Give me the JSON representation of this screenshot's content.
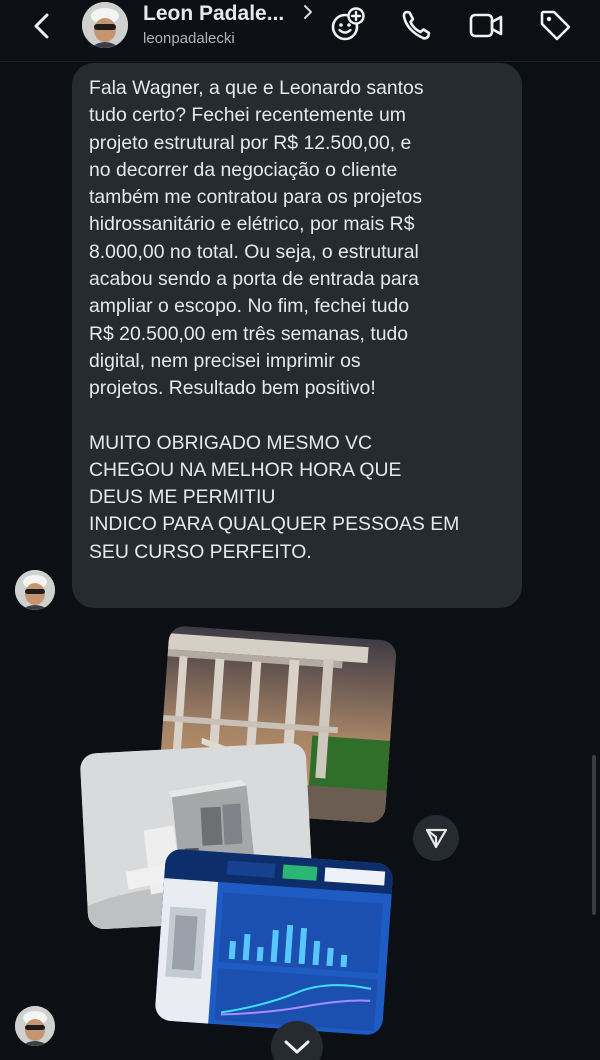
{
  "header": {
    "contact_name": "Leon Padale...",
    "handle": "leonpadalecki"
  },
  "message": {
    "paragraph1": "Fala Wagner, a que e Leonardo santos\ntudo certo? Fechei recentemente um\nprojeto estrutural por R$ 12.500,00, e\nno decorrer da negociação o cliente\ntambém me contratou para os projetos\nhidrossanitário e elétrico, por mais R$\n8.000,00 no total. Ou seja, o estrutural\nacabou sendo a porta de entrada para\nampliar o escopo. No fim, fechei tudo\nR$ 20.500,00 em três semanas, tudo\ndigital, nem precisei imprimir os\nprojetos. Resultado bem positivo!",
    "paragraph2": "MUITO OBRIGADO MESMO VC\nCHEGOU NA MELHOR HORA QUE\nDEUS ME PERMITIU\nINDICO PARA QUALQUER PESSOAS EM\nSEU  CURSO PERFEITO."
  },
  "icons": {
    "back": "chevron-left-icon",
    "name_chevron": "chevron-right-icon",
    "effects": "sticker-effects-icon",
    "call": "phone-icon",
    "video": "video-camera-icon",
    "tag": "tag-icon",
    "share": "send-icon",
    "scroll": "chevron-down-icon"
  },
  "colors": {
    "background": "#0c0f14",
    "bubble": "#262a31",
    "text": "#e6e8eb",
    "dashboard_blue": "#1e5cc4"
  }
}
